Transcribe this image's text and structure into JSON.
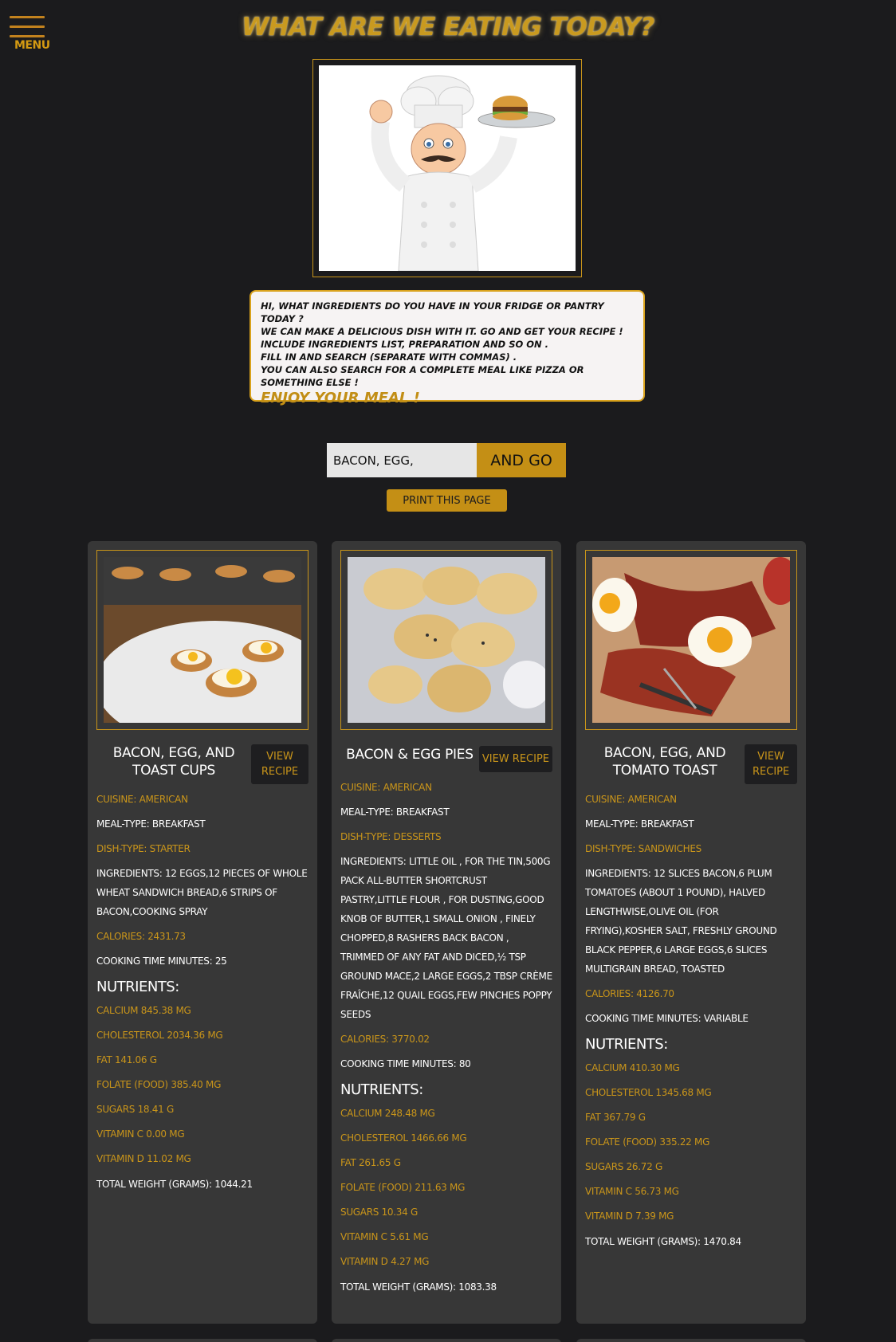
{
  "menu": {
    "label": "MENU"
  },
  "header": {
    "title": "WHAT ARE WE EATING TODAY?"
  },
  "intro": {
    "lines": [
      "HI, WHAT INGREDIENTS DO YOU HAVE IN YOUR FRIDGE OR PANTRY TODAY ?",
      "WE CAN MAKE A DELICIOUS DISH WITH IT. GO AND GET YOUR RECIPE !",
      "INCLUDE INGREDIENTS LIST, PREPARATION AND SO ON .",
      "FILL IN AND SEARCH (SEPARATE WITH COMMAS) .",
      "YOU CAN ALSO SEARCH FOR A COMPLETE MEAL LIKE PIZZA OR SOMETHING ELSE !"
    ],
    "enjoy": "ENJOY YOUR MEAL !"
  },
  "search": {
    "value": "BACON, EGG,",
    "button": "AND GO"
  },
  "print_button": "PRINT THIS PAGE",
  "nutrients_heading": "NUTRIENTS:",
  "cards": [
    {
      "name": "BACON, EGG, AND TOAST CUPS",
      "view": "VIEW RECIPE",
      "cuisine": "CUISINE: AMERICAN",
      "meal": "MEAL-TYPE: BREAKFAST",
      "dish": "DISH-TYPE: STARTER",
      "ingredients": "INGREDIENTS: 12 EGGS,12 PIECES OF WHOLE WHEAT SANDWICH BREAD,6 STRIPS OF BACON,COOKING SPRAY",
      "calories": "CALORIES: 2431.73",
      "time": "COOKING TIME MINUTES: 25",
      "nutrients": [
        "CALCIUM 845.38 MG",
        "CHOLESTEROL 2034.36 MG",
        "FAT 141.06 G",
        "FOLATE (FOOD) 385.40 µG",
        "SUGARS 18.41 G",
        "VITAMIN C 0.00 MG",
        "VITAMIN D 11.02 µG"
      ],
      "total": "TOTAL WEIGHT (GRAMS): 1044.21"
    },
    {
      "name": "BACON & EGG PIES",
      "view": "VIEW RECIPE",
      "cuisine": "CUISINE: AMERICAN",
      "meal": "MEAL-TYPE: BREAKFAST",
      "dish": "DISH-TYPE: DESSERTS",
      "ingredients": "INGREDIENTS: LITTLE OIL , FOR THE TIN,500G PACK ALL-BUTTER SHORTCRUST PASTRY,LITTLE FLOUR , FOR DUSTING,GOOD KNOB OF BUTTER,1 SMALL ONION , FINELY CHOPPED,8 RASHERS BACK BACON , TRIMMED OF ANY FAT AND DICED,½ TSP GROUND MACE,2 LARGE EGGS,2 TBSP CRÈME FRAÎCHE,12 QUAIL EGGS,FEW PINCHES POPPY SEEDS",
      "calories": "CALORIES: 3770.02",
      "time": "COOKING TIME MINUTES: 80",
      "nutrients": [
        "CALCIUM 248.48 MG",
        "CHOLESTEROL 1466.66 MG",
        "FAT 261.65 G",
        "FOLATE (FOOD) 211.63 µG",
        "SUGARS 10.34 G",
        "VITAMIN C 5.61 MG",
        "VITAMIN D 4.27 µG"
      ],
      "total": "TOTAL WEIGHT (GRAMS): 1083.38"
    },
    {
      "name": "BACON, EGG, AND TOMATO TOAST",
      "view": "VIEW RECIPE",
      "cuisine": "CUISINE: AMERICAN",
      "meal": "MEAL-TYPE: BREAKFAST",
      "dish": "DISH-TYPE: SANDWICHES",
      "ingredients": "INGREDIENTS: 12 SLICES BACON,6 PLUM TOMATOES (ABOUT 1 POUND), HALVED LENGTHWISE,OLIVE OIL (FOR FRYING),KOSHER SALT, FRESHLY GROUND BLACK PEPPER,6 LARGE EGGS,6 SLICES MULTIGRAIN BREAD, TOASTED",
      "calories": "CALORIES: 4126.70",
      "time": "COOKING TIME MINUTES: VARIABLE",
      "nutrients": [
        "CALCIUM 410.30 MG",
        "CHOLESTEROL 1345.68 MG",
        "FAT 367.79 G",
        "FOLATE (FOOD) 335.22 µG",
        "SUGARS 26.72 G",
        "VITAMIN C 56.73 MG",
        "VITAMIN D 7.39 µG"
      ],
      "total": "TOTAL WEIGHT (GRAMS): 1470.84"
    }
  ]
}
